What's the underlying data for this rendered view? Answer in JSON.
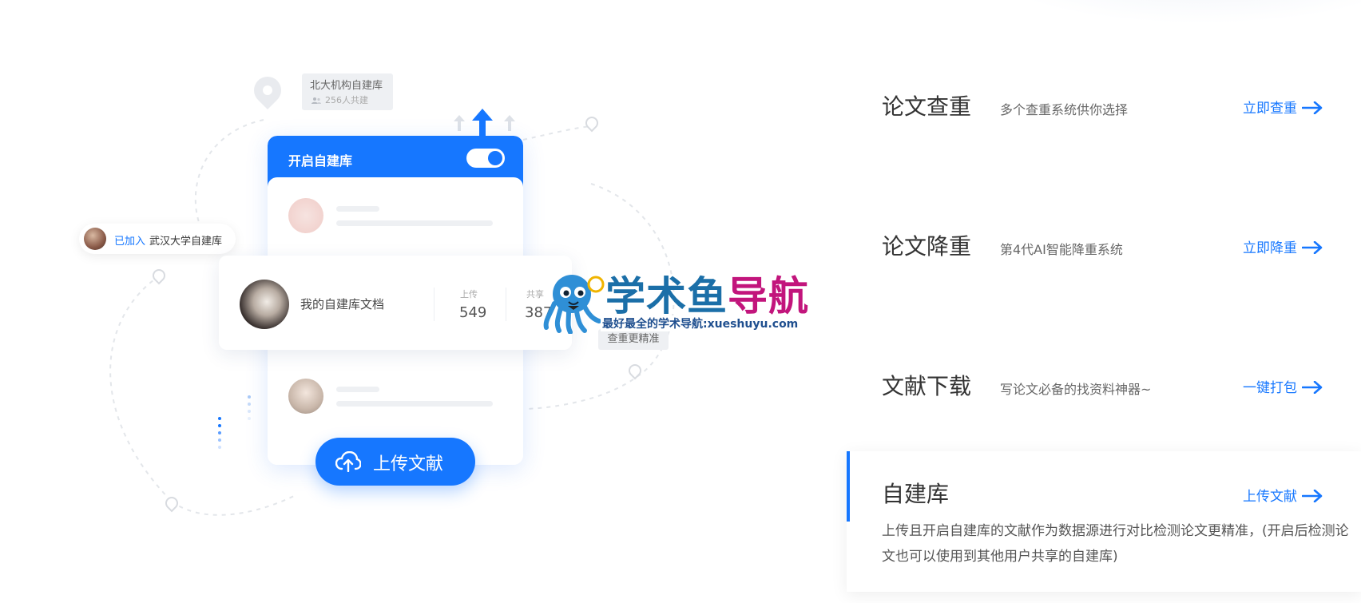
{
  "illustration": {
    "org_tag": {
      "name": "北大机构自建库",
      "count": "256人共建"
    },
    "phone_header": {
      "title": "开启自建库"
    },
    "joined_tag": {
      "status": "已加入",
      "library": "武汉大学自建库"
    },
    "my_card": {
      "title": "我的自建库文档",
      "stats": [
        {
          "label": "上传",
          "value": "549"
        },
        {
          "label": "共享",
          "value": "387"
        }
      ]
    },
    "accuracy_tag": "查重更精准",
    "upload_button": "上传文献"
  },
  "watermark": {
    "title_part1": "学术鱼",
    "title_part2": "导航",
    "subtitle": "最好最全的学术导航:xueshuyu.com"
  },
  "features": [
    {
      "title": "论文查重",
      "desc": "多个查重系统供你选择",
      "link": "立即查重"
    },
    {
      "title": "论文降重",
      "desc": "第4代AI智能降重系统",
      "link": "立即降重"
    },
    {
      "title": "文献下载",
      "desc": "写论文必备的找资料神器~",
      "link": "一键打包"
    }
  ],
  "active_feature": {
    "title": "自建库",
    "link": "上传文献",
    "desc": "上传且开启自建库的文献作为数据源进行对比检测论文更精准，(开启后检测论文也可以使用到其他用户共享的自建库)"
  },
  "colors": {
    "accent": "#1677ff",
    "watermark_blue": "#1b6fa8",
    "watermark_magenta": "#c2157c"
  }
}
